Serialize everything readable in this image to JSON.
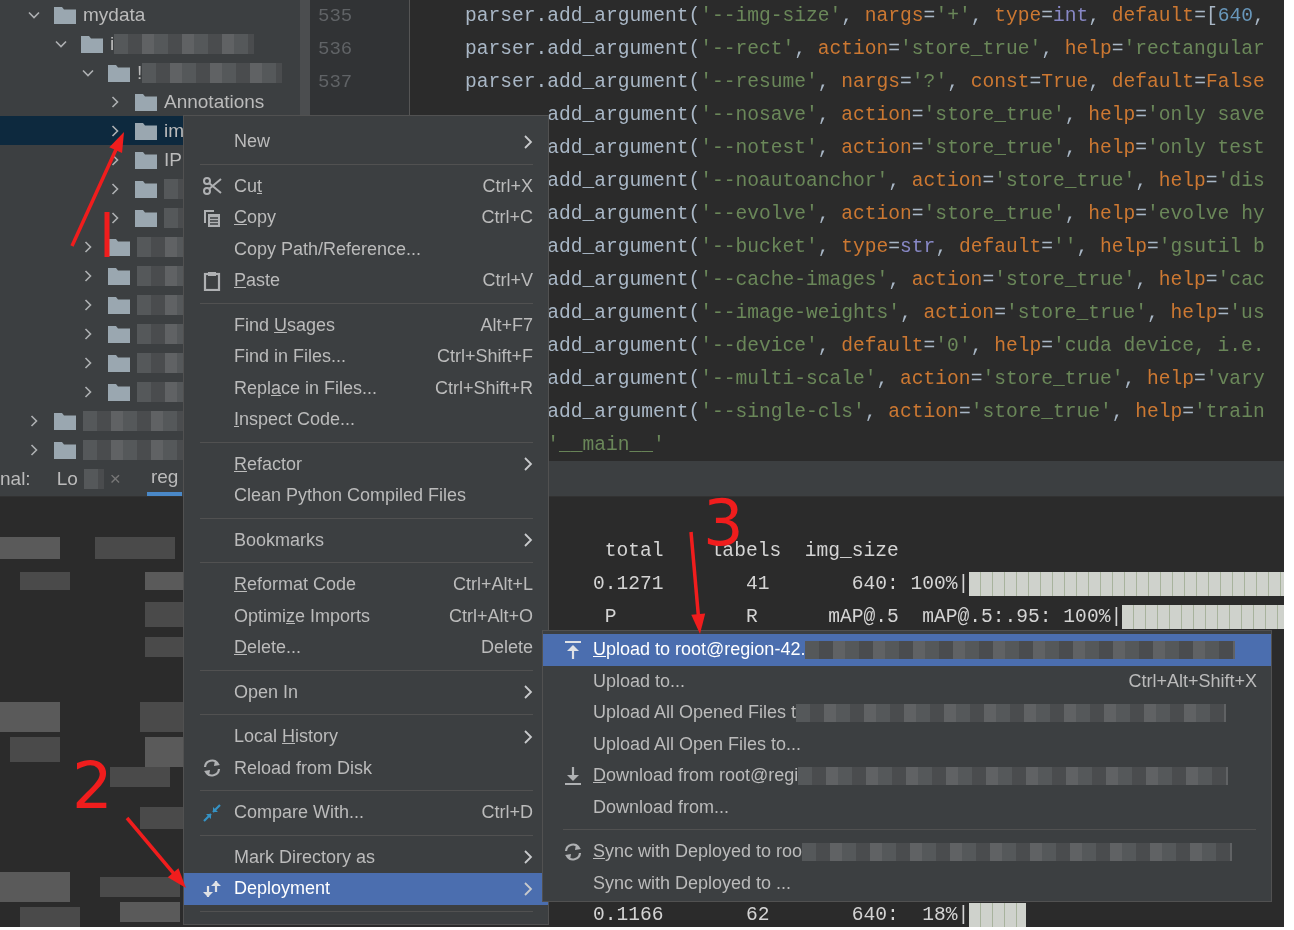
{
  "project_tree": [
    {
      "label": "mydata",
      "expanded": true,
      "selected": false,
      "children": [
        {
          "label": "i",
          "redacted": true,
          "expanded": true,
          "selected": false,
          "children": [
            {
              "label": "!",
              "redacted": true,
              "expanded": true,
              "selected": false,
              "children": [
                {
                  "label": "Annotations",
                  "expanded": false,
                  "selected": false
                },
                {
                  "label": "im",
                  "expanded": false,
                  "selected": true
                },
                {
                  "label": "IP",
                  "expanded": false,
                  "selected": false
                },
                {
                  "redacted": true,
                  "expanded": false,
                  "selected": false
                },
                {
                  "redacted": true,
                  "expanded": false,
                  "selected": false
                }
              ]
            },
            {
              "redacted": true,
              "expanded": false,
              "selected": false
            },
            {
              "redacted": true,
              "expanded": false,
              "selected": false
            },
            {
              "redacted": true,
              "expanded": false,
              "selected": false
            },
            {
              "redacted": true,
              "expanded": false,
              "selected": false
            },
            {
              "redacted": true,
              "expanded": false,
              "selected": false
            },
            {
              "redacted": true,
              "expanded": false,
              "selected": false
            }
          ]
        }
      ]
    },
    {
      "redacted": true,
      "expanded": false,
      "selected": false
    },
    {
      "redacted": true,
      "expanded": false,
      "selected": false
    }
  ],
  "editor": {
    "line_numbers": [
      "535",
      "536",
      "537"
    ],
    "lines": [
      {
        "kind": "full",
        "tokens": [
          {
            "kind": "plain",
            "text": "parser.add_argument("
          },
          {
            "kind": "str",
            "text": "'--img-size'"
          },
          {
            "kind": "plain",
            "text": ", "
          },
          {
            "kind": "kw",
            "text": "nargs"
          },
          {
            "kind": "plain",
            "text": "="
          },
          {
            "kind": "str",
            "text": "'+'"
          },
          {
            "kind": "plain",
            "text": ", "
          },
          {
            "kind": "kw",
            "text": "type"
          },
          {
            "kind": "plain",
            "text": "="
          },
          {
            "kind": "builtin",
            "text": "int"
          },
          {
            "kind": "plain",
            "text": ", "
          },
          {
            "kind": "kw",
            "text": "default"
          },
          {
            "kind": "plain",
            "text": "=["
          },
          {
            "kind": "num",
            "text": "640"
          },
          {
            "kind": "plain",
            "text": ","
          }
        ]
      },
      {
        "kind": "full",
        "tokens": [
          {
            "kind": "plain",
            "text": "parser.add_argument("
          },
          {
            "kind": "str",
            "text": "'--rect'"
          },
          {
            "kind": "plain",
            "text": ", "
          },
          {
            "kind": "kw",
            "text": "action"
          },
          {
            "kind": "plain",
            "text": "="
          },
          {
            "kind": "str",
            "text": "'store_true'"
          },
          {
            "kind": "plain",
            "text": ", "
          },
          {
            "kind": "kw",
            "text": "help"
          },
          {
            "kind": "plain",
            "text": "="
          },
          {
            "kind": "str",
            "text": "'rectangular"
          }
        ]
      },
      {
        "kind": "full",
        "tokens": [
          {
            "kind": "plain",
            "text": "parser.add_argument("
          },
          {
            "kind": "str",
            "text": "'--resume'"
          },
          {
            "kind": "plain",
            "text": ", "
          },
          {
            "kind": "kw",
            "text": "nargs"
          },
          {
            "kind": "plain",
            "text": "="
          },
          {
            "kind": "str",
            "text": "'?'"
          },
          {
            "kind": "plain",
            "text": ", "
          },
          {
            "kind": "kw",
            "text": "const"
          },
          {
            "kind": "plain",
            "text": "="
          },
          {
            "kind": "kw",
            "text": "True"
          },
          {
            "kind": "plain",
            "text": ", "
          },
          {
            "kind": "kw",
            "text": "default"
          },
          {
            "kind": "plain",
            "text": "="
          },
          {
            "kind": "kw",
            "text": "False"
          }
        ]
      },
      {
        "kind": "covered",
        "tokens": [
          {
            "kind": "plain",
            "text": "add_argument("
          },
          {
            "kind": "str",
            "text": "'--nosave'"
          },
          {
            "kind": "plain",
            "text": ", "
          },
          {
            "kind": "kw",
            "text": "action"
          },
          {
            "kind": "plain",
            "text": "="
          },
          {
            "kind": "str",
            "text": "'store_true'"
          },
          {
            "kind": "plain",
            "text": ", "
          },
          {
            "kind": "kw",
            "text": "help"
          },
          {
            "kind": "plain",
            "text": "="
          },
          {
            "kind": "str",
            "text": "'only save"
          }
        ]
      },
      {
        "kind": "covered",
        "tokens": [
          {
            "kind": "plain",
            "text": "add_argument("
          },
          {
            "kind": "str",
            "text": "'--notest'"
          },
          {
            "kind": "plain",
            "text": ", "
          },
          {
            "kind": "kw",
            "text": "action"
          },
          {
            "kind": "plain",
            "text": "="
          },
          {
            "kind": "str",
            "text": "'store_true'"
          },
          {
            "kind": "plain",
            "text": ", "
          },
          {
            "kind": "kw",
            "text": "help"
          },
          {
            "kind": "plain",
            "text": "="
          },
          {
            "kind": "str",
            "text": "'only test"
          }
        ]
      },
      {
        "kind": "covered",
        "tokens": [
          {
            "kind": "plain",
            "text": "add_argument("
          },
          {
            "kind": "str",
            "text": "'--noautoanchor'"
          },
          {
            "kind": "plain",
            "text": ", "
          },
          {
            "kind": "kw",
            "text": "action"
          },
          {
            "kind": "plain",
            "text": "="
          },
          {
            "kind": "str",
            "text": "'store_true'"
          },
          {
            "kind": "plain",
            "text": ", "
          },
          {
            "kind": "kw",
            "text": "help"
          },
          {
            "kind": "plain",
            "text": "="
          },
          {
            "kind": "str",
            "text": "'dis"
          }
        ]
      },
      {
        "kind": "covered",
        "tokens": [
          {
            "kind": "plain",
            "text": "add_argument("
          },
          {
            "kind": "str",
            "text": "'--evolve'"
          },
          {
            "kind": "plain",
            "text": ", "
          },
          {
            "kind": "kw",
            "text": "action"
          },
          {
            "kind": "plain",
            "text": "="
          },
          {
            "kind": "str",
            "text": "'store_true'"
          },
          {
            "kind": "plain",
            "text": ", "
          },
          {
            "kind": "kw",
            "text": "help"
          },
          {
            "kind": "plain",
            "text": "="
          },
          {
            "kind": "str",
            "text": "'evolve hy"
          }
        ]
      },
      {
        "kind": "covered",
        "tokens": [
          {
            "kind": "plain",
            "text": "add_argument("
          },
          {
            "kind": "str",
            "text": "'--bucket'"
          },
          {
            "kind": "plain",
            "text": ", "
          },
          {
            "kind": "kw",
            "text": "type"
          },
          {
            "kind": "plain",
            "text": "="
          },
          {
            "kind": "builtin",
            "text": "str"
          },
          {
            "kind": "plain",
            "text": ", "
          },
          {
            "kind": "kw",
            "text": "default"
          },
          {
            "kind": "plain",
            "text": "="
          },
          {
            "kind": "str",
            "text": "''"
          },
          {
            "kind": "plain",
            "text": ", "
          },
          {
            "kind": "kw",
            "text": "help"
          },
          {
            "kind": "plain",
            "text": "="
          },
          {
            "kind": "str",
            "text": "'gsutil b"
          }
        ]
      },
      {
        "kind": "covered",
        "tokens": [
          {
            "kind": "plain",
            "text": "add_argument("
          },
          {
            "kind": "str",
            "text": "'--cache-images'"
          },
          {
            "kind": "plain",
            "text": ", "
          },
          {
            "kind": "kw",
            "text": "action"
          },
          {
            "kind": "plain",
            "text": "="
          },
          {
            "kind": "str",
            "text": "'store_true'"
          },
          {
            "kind": "plain",
            "text": ", "
          },
          {
            "kind": "kw",
            "text": "help"
          },
          {
            "kind": "plain",
            "text": "="
          },
          {
            "kind": "str",
            "text": "'cac"
          }
        ]
      },
      {
        "kind": "covered",
        "tokens": [
          {
            "kind": "plain",
            "text": "add_argument("
          },
          {
            "kind": "str",
            "text": "'--image-weights'"
          },
          {
            "kind": "plain",
            "text": ", "
          },
          {
            "kind": "kw",
            "text": "action"
          },
          {
            "kind": "plain",
            "text": "="
          },
          {
            "kind": "str",
            "text": "'store_true'"
          },
          {
            "kind": "plain",
            "text": ", "
          },
          {
            "kind": "kw",
            "text": "help"
          },
          {
            "kind": "plain",
            "text": "="
          },
          {
            "kind": "str",
            "text": "'us"
          }
        ]
      },
      {
        "kind": "covered",
        "tokens": [
          {
            "kind": "plain",
            "text": "add_argument("
          },
          {
            "kind": "str",
            "text": "'--device'"
          },
          {
            "kind": "plain",
            "text": ", "
          },
          {
            "kind": "kw",
            "text": "default"
          },
          {
            "kind": "plain",
            "text": "="
          },
          {
            "kind": "str",
            "text": "'0'"
          },
          {
            "kind": "plain",
            "text": ", "
          },
          {
            "kind": "kw",
            "text": "help"
          },
          {
            "kind": "plain",
            "text": "="
          },
          {
            "kind": "str",
            "text": "'cuda device, i.e."
          }
        ]
      },
      {
        "kind": "covered",
        "tokens": [
          {
            "kind": "plain",
            "text": "add_argument("
          },
          {
            "kind": "str",
            "text": "'--multi-scale'"
          },
          {
            "kind": "plain",
            "text": ", "
          },
          {
            "kind": "kw",
            "text": "action"
          },
          {
            "kind": "plain",
            "text": "="
          },
          {
            "kind": "str",
            "text": "'store_true'"
          },
          {
            "kind": "plain",
            "text": ", "
          },
          {
            "kind": "kw",
            "text": "help"
          },
          {
            "kind": "plain",
            "text": "="
          },
          {
            "kind": "str",
            "text": "'vary"
          }
        ]
      },
      {
        "kind": "covered",
        "tokens": [
          {
            "kind": "plain",
            "text": "add_argument("
          },
          {
            "kind": "str",
            "text": "'--single-cls'"
          },
          {
            "kind": "plain",
            "text": ", "
          },
          {
            "kind": "kw",
            "text": "action"
          },
          {
            "kind": "plain",
            "text": "="
          },
          {
            "kind": "str",
            "text": "'store_true'"
          },
          {
            "kind": "plain",
            "text": ", "
          },
          {
            "kind": "kw",
            "text": "help"
          },
          {
            "kind": "plain",
            "text": "="
          },
          {
            "kind": "str",
            "text": "'train"
          }
        ]
      },
      {
        "kind": "covered",
        "tokens": [
          {
            "kind": "str",
            "text": "'__main__'"
          }
        ]
      }
    ]
  },
  "terminal": {
    "title": "nal:",
    "tabs": [
      {
        "label": "Lo",
        "redacted": true,
        "close": "×",
        "selected": false
      },
      {
        "label": "reg",
        "selected": true
      }
    ],
    "lines": [
      {
        "kind": "text",
        "text": "     total    labels  img_size"
      },
      {
        "kind": "progress",
        "text": "    0.1271       41       640: 100%|",
        "level": 1
      },
      {
        "kind": "progress",
        "text": "     P           R      mAP@.5  mAP@.5:.95: 100%|",
        "level": 1
      },
      {
        "kind": "progress",
        "text": "    0.1166       62       640:  18%|",
        "level": 0.18
      }
    ]
  },
  "context_menu": [
    {
      "kind": "item",
      "label": "New",
      "submenu": true,
      "selected": false
    },
    {
      "kind": "separator"
    },
    {
      "kind": "item",
      "pre": "Cu",
      "key": "t",
      "shortcut": "Ctrl+X",
      "selected": false
    },
    {
      "kind": "item",
      "key": "C",
      "post": "opy",
      "shortcut": "Ctrl+C",
      "selected": false
    },
    {
      "kind": "item",
      "label": "Copy Path/Reference...",
      "selected": false
    },
    {
      "kind": "item",
      "key": "P",
      "post": "aste",
      "shortcut": "Ctrl+V",
      "selected": false
    },
    {
      "kind": "separator"
    },
    {
      "kind": "item",
      "pre": "Find ",
      "key": "U",
      "post": "sages",
      "shortcut": "Alt+F7",
      "selected": false
    },
    {
      "kind": "item",
      "label": "Find in Files...",
      "shortcut": "Ctrl+Shift+F",
      "selected": false
    },
    {
      "kind": "item",
      "pre": "Repl",
      "key": "a",
      "post": "ce in Files...",
      "shortcut": "Ctrl+Shift+R",
      "selected": false
    },
    {
      "kind": "item",
      "key": "I",
      "post": "nspect Code...",
      "selected": false
    },
    {
      "kind": "separator"
    },
    {
      "kind": "item",
      "key": "R",
      "post": "efactor",
      "submenu": true,
      "selected": false
    },
    {
      "kind": "item",
      "label": "Clean Python Compiled Files",
      "selected": false
    },
    {
      "kind": "separator"
    },
    {
      "kind": "item",
      "label": "Bookmarks",
      "submenu": true,
      "selected": false
    },
    {
      "kind": "separator"
    },
    {
      "kind": "item",
      "key": "R",
      "post": "eformat Code",
      "shortcut": "Ctrl+Alt+L",
      "selected": false
    },
    {
      "kind": "item",
      "pre": "Optimi",
      "key": "z",
      "post": "e Imports",
      "shortcut": "Ctrl+Alt+O",
      "selected": false
    },
    {
      "kind": "item",
      "key": "D",
      "post": "elete...",
      "shortcut": "Delete",
      "selected": false
    },
    {
      "kind": "separator"
    },
    {
      "kind": "item",
      "label": "Open In",
      "submenu": true,
      "selected": false
    },
    {
      "kind": "separator"
    },
    {
      "kind": "item",
      "pre": "Local ",
      "key": "H",
      "post": "istory",
      "submenu": true,
      "selected": false
    },
    {
      "kind": "item",
      "label": "Reload from Disk",
      "selected": false
    },
    {
      "kind": "separator"
    },
    {
      "kind": "item",
      "label": "Compare With...",
      "shortcut": "Ctrl+D",
      "selected": false
    },
    {
      "kind": "separator"
    },
    {
      "kind": "item",
      "label": "Mark Directory as",
      "submenu": true,
      "selected": false
    },
    {
      "kind": "item",
      "label": "Deployment",
      "submenu": true,
      "selected": true
    },
    {
      "kind": "separator"
    }
  ],
  "deployment_submenu": [
    {
      "kind": "item",
      "key": "U",
      "post": "pload to root@region-42.",
      "redacted": true,
      "selected": true
    },
    {
      "kind": "item",
      "label": "Upload to...",
      "shortcut": "Ctrl+Alt+Shift+X",
      "selected": false
    },
    {
      "kind": "item",
      "label": "Upload All Opened Files t",
      "redacted": true,
      "selected": false
    },
    {
      "kind": "item",
      "label": "Upload All Open Files to...",
      "selected": false
    },
    {
      "kind": "item",
      "key": "D",
      "post": "ownload from root@regi",
      "redacted": true,
      "selected": false
    },
    {
      "kind": "item",
      "label": "Download from...",
      "selected": false
    },
    {
      "kind": "separator"
    },
    {
      "kind": "item",
      "key": "S",
      "post": "ync with Deployed to roo",
      "redacted": true,
      "selected": false
    },
    {
      "kind": "item",
      "label": "Sync with Deployed to ...",
      "selected": false
    }
  ],
  "annotations": [
    {
      "kind": "arrow"
    },
    {
      "kind": "stroke"
    },
    {
      "kind": "number",
      "text": "2"
    },
    {
      "kind": "arrow"
    },
    {
      "kind": "number",
      "text": "3"
    },
    {
      "kind": "arrow"
    }
  ]
}
